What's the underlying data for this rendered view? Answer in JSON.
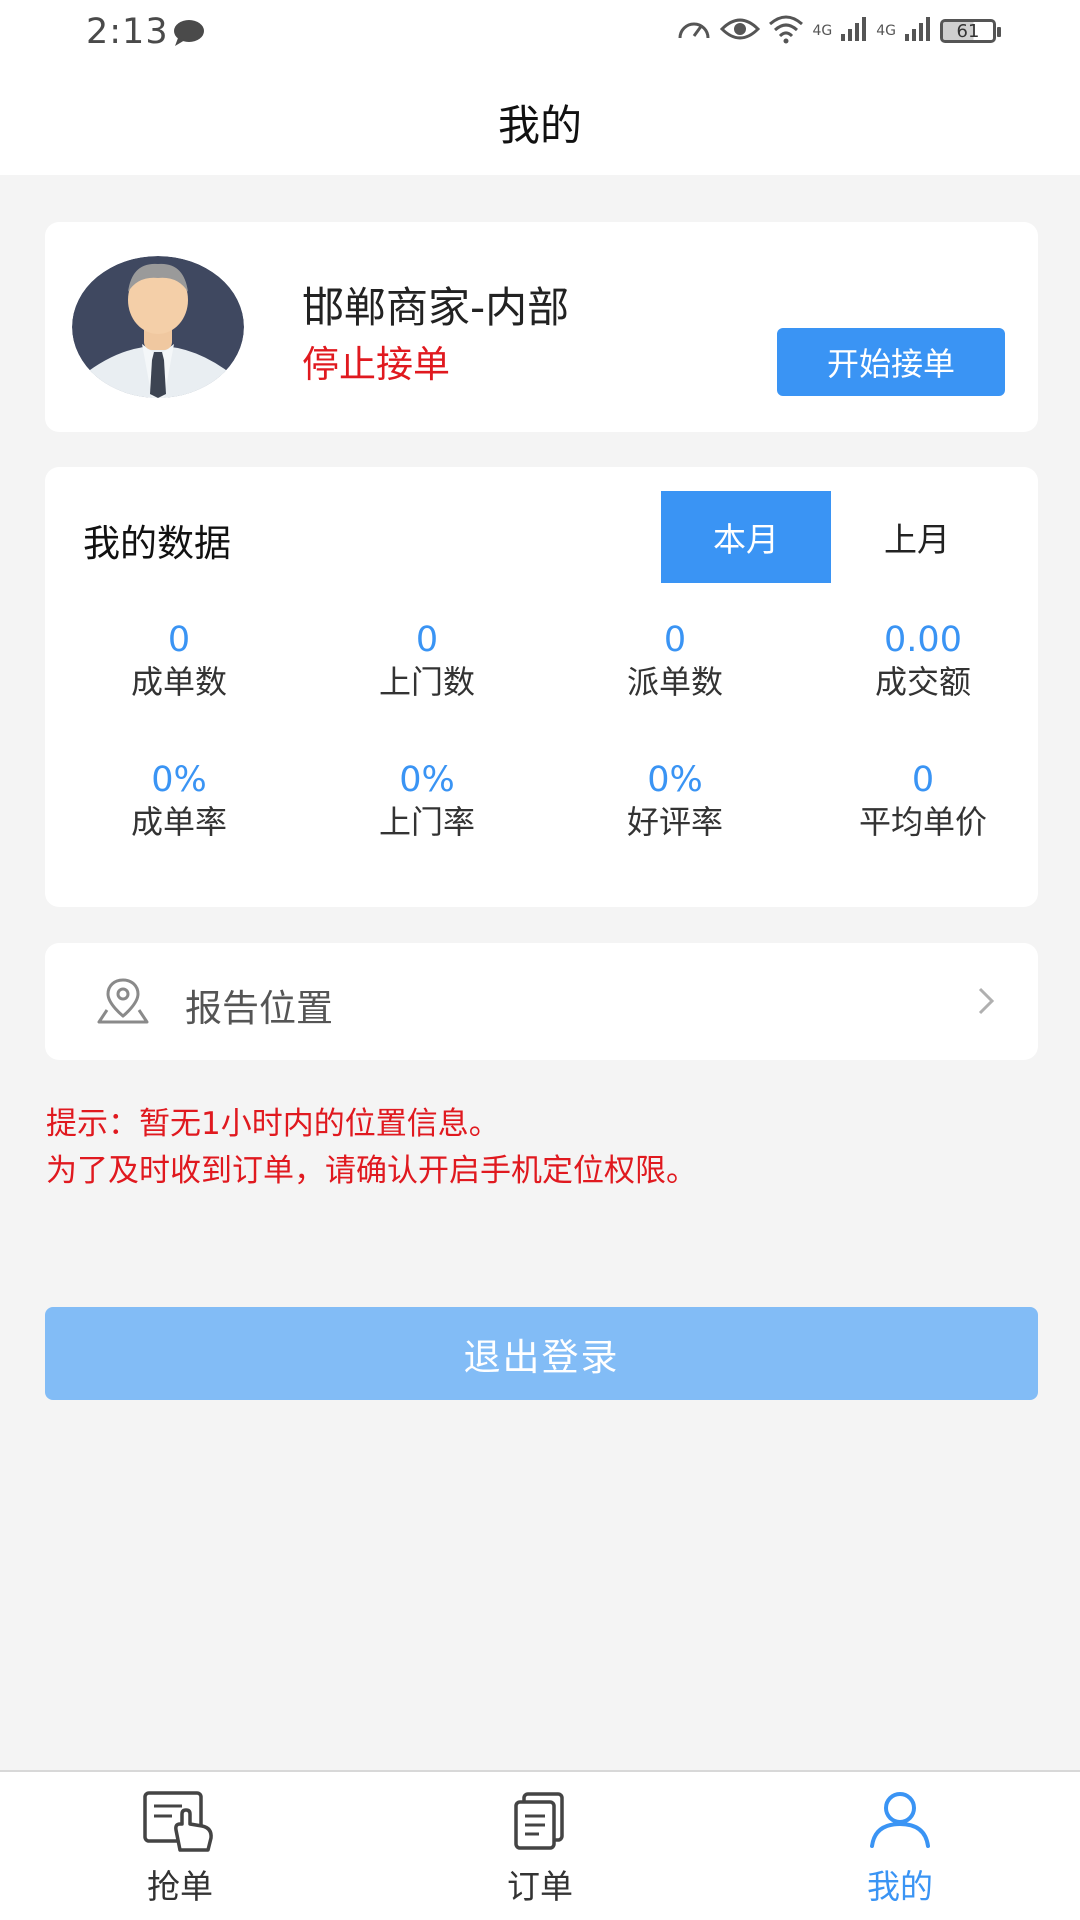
{
  "status_bar": {
    "time": "2:13",
    "network_1": "4G",
    "network_2": "4G",
    "battery": "61"
  },
  "header": {
    "title": "我的"
  },
  "profile": {
    "name": "邯郸商家-内部",
    "status": "停止接单",
    "start_button": "开始接单"
  },
  "my_data": {
    "title": "我的数据",
    "tabs": [
      "本月",
      "上月"
    ],
    "active_tab": "本月",
    "stats": [
      {
        "value": "0",
        "label": "成单数"
      },
      {
        "value": "0",
        "label": "上门数"
      },
      {
        "value": "0",
        "label": "派单数"
      },
      {
        "value": "0.00",
        "label": "成交额"
      },
      {
        "value": "0%",
        "label": "成单率"
      },
      {
        "value": "0%",
        "label": "上门率"
      },
      {
        "value": "0%",
        "label": "好评率"
      },
      {
        "value": "0",
        "label": "平均单价"
      }
    ]
  },
  "report_location": {
    "label": "报告位置"
  },
  "tips": {
    "line1": "提示：暂无1小时内的位置信息。",
    "line2": "为了及时收到订单，请确认开启手机定位权限。"
  },
  "logout_button": "退出登录",
  "bottom_nav": {
    "items": [
      {
        "label": "抢单",
        "icon": "grab-order-icon"
      },
      {
        "label": "订单",
        "icon": "order-list-icon"
      },
      {
        "label": "我的",
        "icon": "user-profile-icon"
      }
    ],
    "active": "我的"
  },
  "colors": {
    "accent": "#3a94f4",
    "alert": "#e0191f",
    "logout_disabled": "#82bcf6",
    "background": "#f4f4f4"
  }
}
